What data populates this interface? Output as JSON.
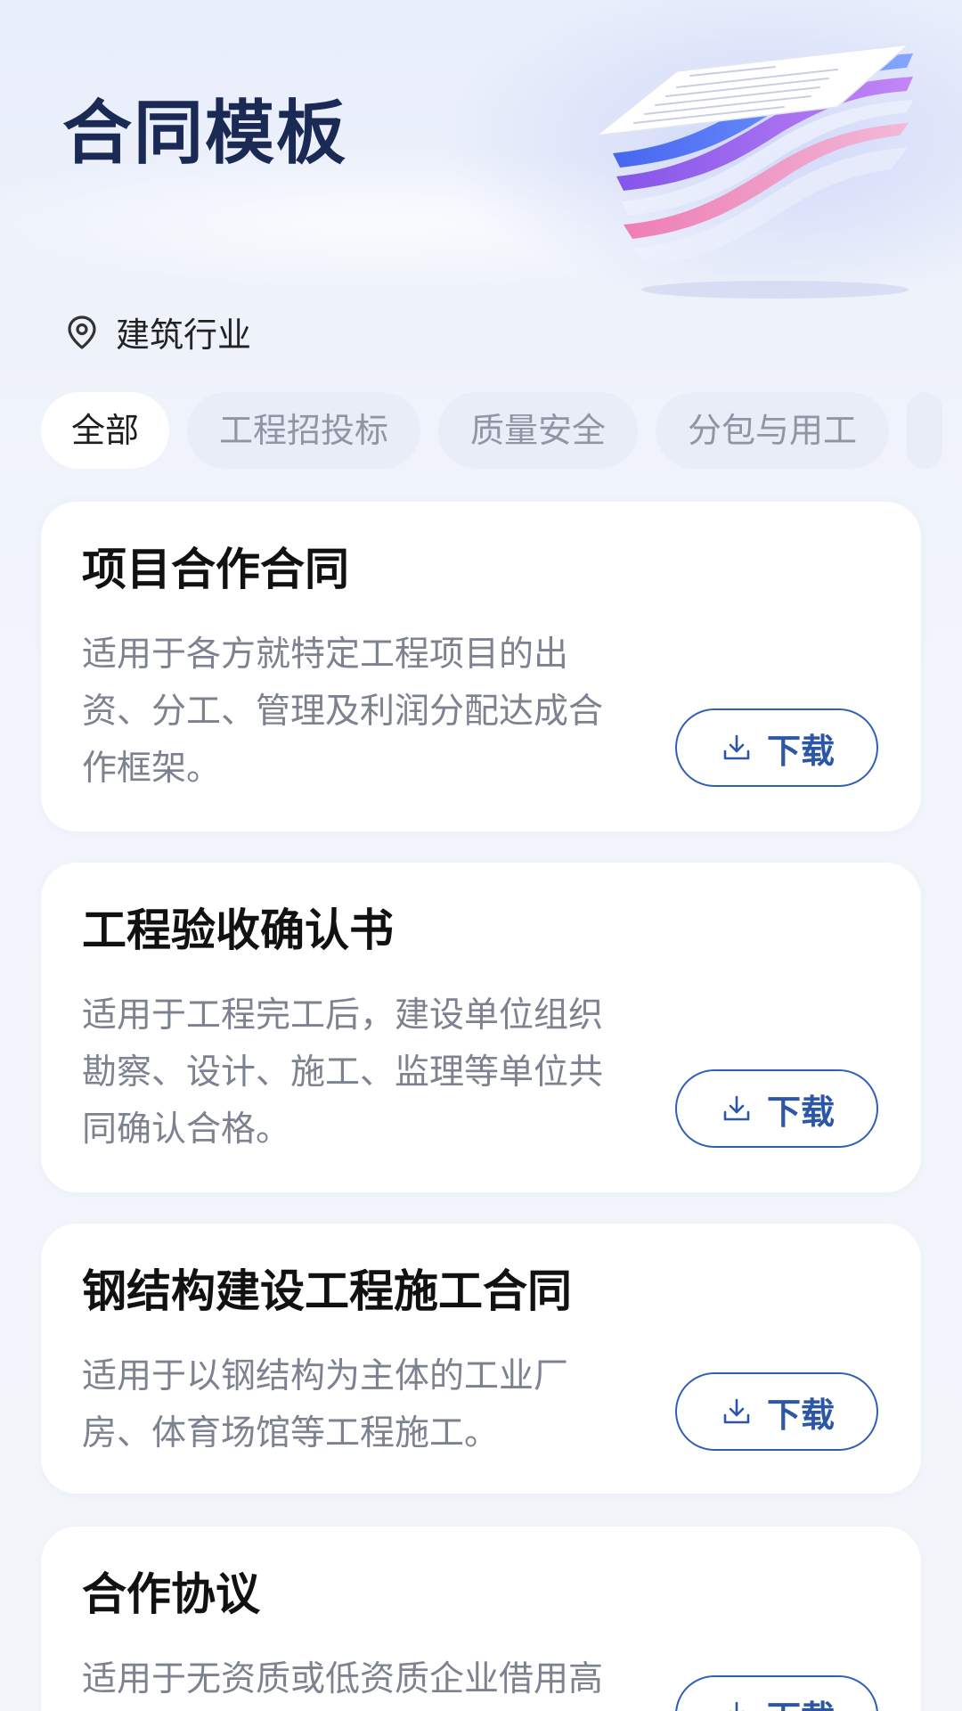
{
  "header": {
    "title": "合同模板",
    "industry": "建筑行业",
    "icons": {
      "location": "location-pin-icon",
      "illustration": "stacked-documents-illustration"
    }
  },
  "tabs": [
    {
      "label": "全部",
      "active": true
    },
    {
      "label": "工程招投标",
      "active": false
    },
    {
      "label": "质量安全",
      "active": false
    },
    {
      "label": "分包与用工",
      "active": false
    }
  ],
  "templates": [
    {
      "title": "项目合作合同",
      "description": "适用于各方就特定工程项目的出资、分工、管理及利润分配达成合作框架。",
      "button": "下载"
    },
    {
      "title": "工程验收确认书",
      "description": "适用于工程完工后，建设单位组织勘察、设计、施工、监理等单位共同确认合格。",
      "button": "下载"
    },
    {
      "title": "钢结构建设工程施工合同",
      "description": "适用于以钢结构为主体的工业厂房、体育场馆等工程施工。",
      "button": "下载"
    },
    {
      "title": "合作协议",
      "description": "适用于无资质或低资质企业借用高",
      "button": "下载"
    }
  ],
  "colors": {
    "title": "#1b2a55",
    "accent": "#2f5fb6",
    "muted_text": "#7d8290",
    "background": "#eef2fb"
  }
}
